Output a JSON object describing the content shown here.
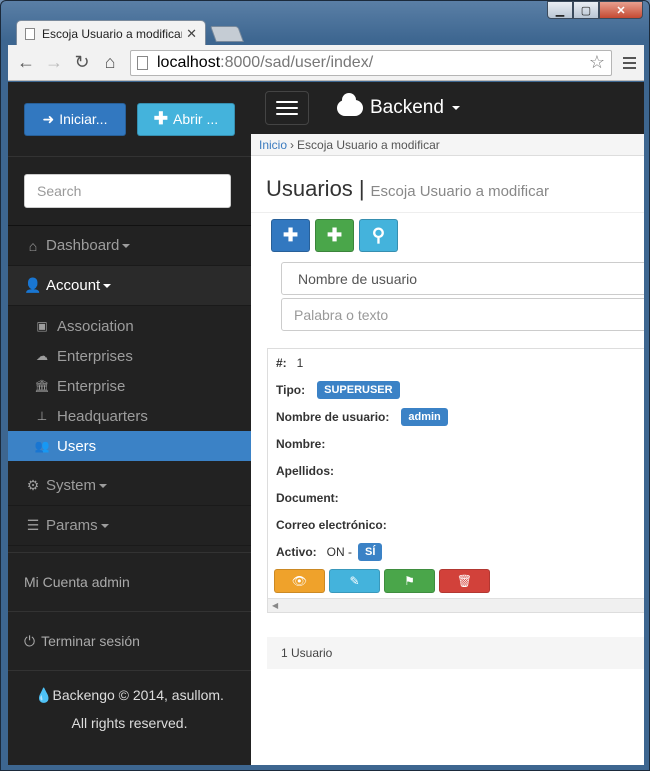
{
  "browser": {
    "tab_title": "Escoja Usuario a modificar",
    "url_host": "localhost",
    "url_path": ":8000/sad/user/index/"
  },
  "sidebar": {
    "btn_login": "Iniciar...",
    "btn_open": "Abrir ...",
    "search_placeholder": "Search",
    "items": [
      {
        "label": "Dashboard",
        "icon": "home-icon"
      },
      {
        "label": "Account",
        "icon": "user-icon"
      }
    ],
    "sub_items": [
      {
        "label": "Association",
        "icon": "association-icon"
      },
      {
        "label": "Enterprises",
        "icon": "cloud-icon"
      },
      {
        "label": "Enterprise",
        "icon": "institution-icon"
      },
      {
        "label": "Headquarters",
        "icon": "sitemap-icon"
      },
      {
        "label": "Users",
        "icon": "users-icon"
      }
    ],
    "system": "System",
    "params": "Params",
    "my_account": "Mi Cuenta admin",
    "logout": "Terminar sesión",
    "footer_line1": "Backengo © 2014, asullom.",
    "footer_line2": "All rights reserved."
  },
  "navbar": {
    "brand": "Backend"
  },
  "breadcrumb": {
    "home": "Inicio",
    "sep": "›",
    "current": "Escoja Usuario a modificar"
  },
  "heading": {
    "title": "Usuarios",
    "separator": "|",
    "subtitle": "Escoja Usuario a modificar"
  },
  "filters": {
    "username_placeholder": "Nombre de usuario",
    "text_placeholder": "Palabra o texto"
  },
  "record": {
    "num_label": "#:",
    "num_value": "1",
    "tipo_label": "Tipo:",
    "tipo_value": "SUPERUSER",
    "username_label": "Nombre de usuario:",
    "username_value": "admin",
    "nombre_label": "Nombre:",
    "apellidos_label": "Apellidos:",
    "document_label": "Document:",
    "email_label": "Correo electrónico:",
    "activo_label": "Activo:",
    "activo_text": "ON -",
    "activo_badge": "SÍ"
  },
  "summary": "1 Usuario",
  "colors": {
    "primary": "#3278c0",
    "info": "#44b3dc",
    "success": "#4aa64a",
    "warning": "#efa22b",
    "danger": "#d2413a"
  }
}
